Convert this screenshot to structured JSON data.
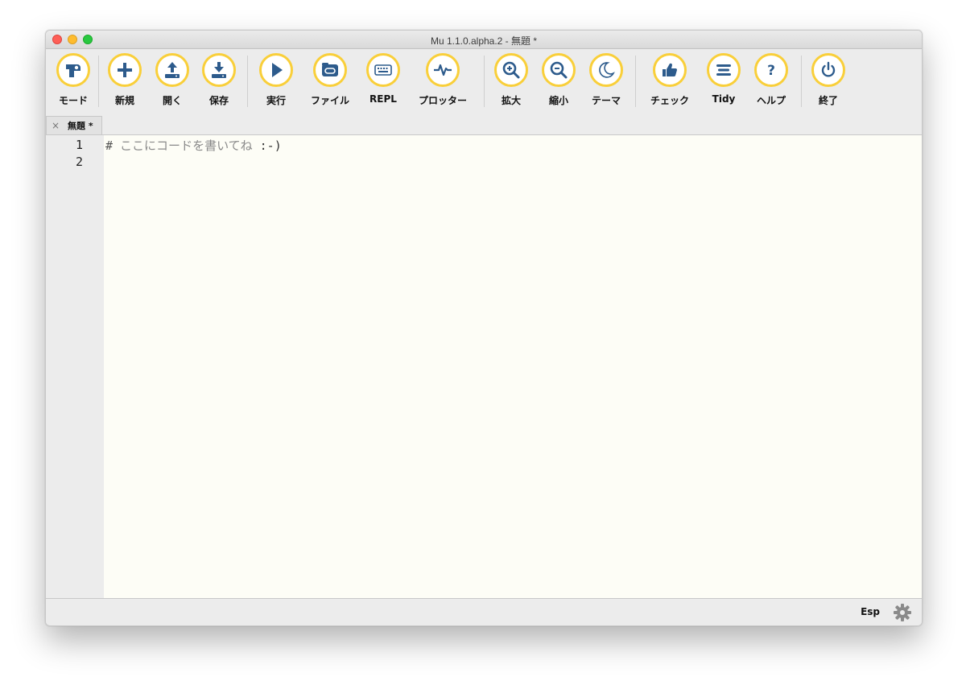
{
  "window": {
    "title": "Mu 1.1.0.alpha.2 - 無題 *"
  },
  "toolbar": {
    "buttons": [
      {
        "label": "モード",
        "icon": "mode-icon"
      },
      {
        "label": "新規",
        "icon": "plus-icon"
      },
      {
        "label": "開く",
        "icon": "upload-icon"
      },
      {
        "label": "保存",
        "icon": "download-icon"
      },
      {
        "label": "実行",
        "icon": "play-icon"
      },
      {
        "label": "ファイル",
        "icon": "files-icon"
      },
      {
        "label": "REPL",
        "icon": "keyboard-icon"
      },
      {
        "label": "プロッター",
        "icon": "pulse-icon"
      },
      {
        "label": "拡大",
        "icon": "zoom-in-icon"
      },
      {
        "label": "縮小",
        "icon": "zoom-out-icon"
      },
      {
        "label": "テーマ",
        "icon": "moon-icon"
      },
      {
        "label": "チェック",
        "icon": "thumbs-up-icon"
      },
      {
        "label": "Tidy",
        "icon": "tidy-icon"
      },
      {
        "label": "ヘルプ",
        "icon": "help-icon"
      },
      {
        "label": "終了",
        "icon": "power-icon"
      }
    ],
    "accent": "#f9cf3a",
    "icon_color": "#2d5b8c"
  },
  "tabs": [
    {
      "label": "無題 *",
      "close": "×"
    }
  ],
  "editor": {
    "line_numbers": [
      "1",
      "2"
    ],
    "lines": [
      {
        "hash": "#",
        "comment": " ここにコードを書いてね ",
        "smile": ":-)"
      },
      {
        "text": ""
      }
    ],
    "background": "#fdfdf6"
  },
  "status": {
    "mode": "Esp",
    "settings_icon": "gear-icon"
  }
}
